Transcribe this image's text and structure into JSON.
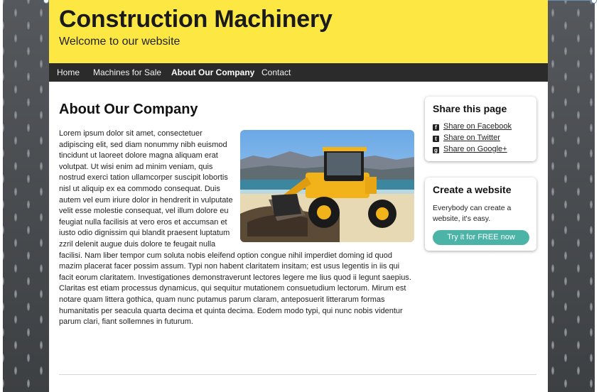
{
  "site": {
    "title": "Construction Machinery",
    "tagline": "Welcome to our website"
  },
  "nav": {
    "items": [
      {
        "label": "Home",
        "active": false
      },
      {
        "label": "Machines for Sale",
        "active": false
      },
      {
        "label": "About Our Company",
        "active": true
      },
      {
        "label": "Contact",
        "active": false
      }
    ]
  },
  "main": {
    "heading": "About Our Company",
    "body": "Lorem ipsum dolor sit amet, consectetuer adipiscing elit, sed diam nonummy nibh euismod tincidunt ut laoreet dolore magna aliquam erat volutpat. Ut wisi enim ad minim veniam, quis nostrud exerci tation ullamcorper suscipit lobortis nisl ut aliquip ex ea commodo consequat. Duis autem vel eum iriure dolor in hendrerit in vulputate velit esse molestie consequat, vel illum dolore eu feugiat nulla facilisis at vero eros et accumsan et iusto odio dignissim qui blandit praesent luptatum zzril delenit augue duis dolore te feugait nulla facilisi. Nam liber tempor cum soluta nobis eleifend option congue nihil imperdiet doming id quod mazim placerat facer possim assum. Typi non habent claritatem insitam; est usus legentis in iis qui facit eorum claritatem. Investigationes demonstraverunt lectores legere me lius quod ii legunt saepius. Claritas est etiam processus dynamicus, qui sequitur mutationem consuetudium lectorum. Mirum est notare quam littera gothica, quam nunc putamus parum claram, anteposuerit litterarum formas humanitatis per seacula quarta decima et quinta decima. Eodem modo typi, qui nunc nobis videntur parum clari, fiant sollemnes in futurum."
  },
  "share_widget": {
    "title": "Share this page",
    "links": [
      {
        "icon": "facebook-icon",
        "label": "Share on Facebook"
      },
      {
        "icon": "twitter-icon",
        "label": "Share on Twitter"
      },
      {
        "icon": "google-plus-icon",
        "label": "Share on Google+"
      }
    ]
  },
  "create_widget": {
    "title": "Create a website",
    "text": "Everybody can create a website, it's easy.",
    "button": "Try it for FREE now"
  },
  "colors": {
    "header_bg": "#fde843",
    "nav_bg": "#2b2b2b",
    "cta_bg": "#4cb4a6"
  }
}
